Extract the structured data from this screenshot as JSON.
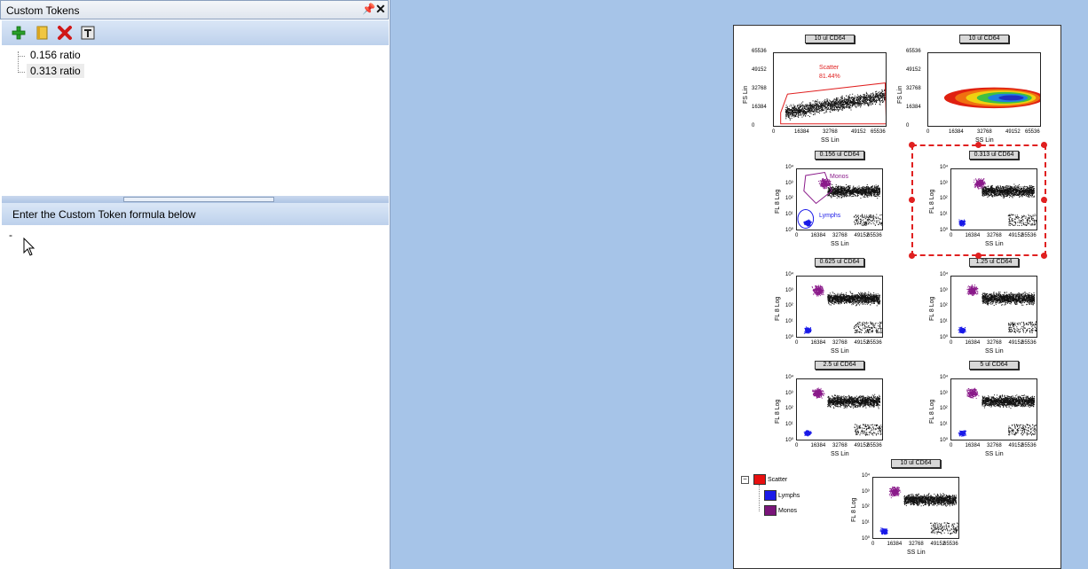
{
  "panel": {
    "title": "Custom Tokens",
    "pin_glyph": "⬇",
    "close_glyph": "✕",
    "toolbar": {
      "add_icon": "add-icon",
      "copy_icon": "copy-icon",
      "delete_icon": "delete-icon",
      "text_icon": "text-icon"
    },
    "tokens": [
      "0.156 ratio",
      "0.313 ratio"
    ],
    "formula_label": "Enter the Custom Token formula below",
    "formula_value": "-"
  },
  "plots": [
    {
      "title": "10  ul CD64",
      "ylabel": "FS Lin",
      "xlabel": "SS Lin",
      "yticks": [
        "65536",
        "49152",
        "32768",
        "16384",
        "0"
      ],
      "xticks": [
        "0",
        "16384",
        "32768",
        "49152",
        "65536"
      ],
      "gate": "Scatter",
      "gate_pct": "81.44%"
    },
    {
      "title": "10  ul CD64",
      "ylabel": "FS Lin",
      "xlabel": "SS Lin",
      "yticks": [
        "65536",
        "49152",
        "32768",
        "16384",
        "0"
      ],
      "xticks": [
        "0",
        "16384",
        "32768",
        "49152",
        "65536"
      ]
    },
    {
      "title": "0.156  ul CD64",
      "ylabel": "FL 8 Log",
      "xlabel": "SS Lin",
      "yticks": [
        "10⁴",
        "10³",
        "10²",
        "10¹",
        "10⁰"
      ],
      "xticks": [
        "0",
        "16384",
        "32768",
        "49152",
        "65536"
      ],
      "gate_monos": "Monos",
      "gate_lymphs": "Lymphs"
    },
    {
      "title": "0.313  ul CD64",
      "ylabel": "FL 8 Log",
      "xlabel": "SS Lin",
      "yticks": [
        "10⁴",
        "10³",
        "10²",
        "10¹",
        "10⁰"
      ],
      "xticks": [
        "0",
        "16384",
        "32768",
        "49152",
        "65536"
      ]
    },
    {
      "title": "0.625  ul CD64",
      "ylabel": "FL 8 Log",
      "xlabel": "SS Lin",
      "yticks": [
        "10⁴",
        "10³",
        "10²",
        "10¹",
        "10⁰"
      ],
      "xticks": [
        "0",
        "16384",
        "32768",
        "49152",
        "65536"
      ]
    },
    {
      "title": "1.25  ul CD64",
      "ylabel": "FL 8 Log",
      "xlabel": "SS Lin",
      "yticks": [
        "10⁴",
        "10³",
        "10²",
        "10¹",
        "10⁰"
      ],
      "xticks": [
        "0",
        "16384",
        "32768",
        "49152",
        "65536"
      ]
    },
    {
      "title": "2.5  ul CD64",
      "ylabel": "FL 8 Log",
      "xlabel": "SS Lin",
      "yticks": [
        "10⁴",
        "10³",
        "10²",
        "10¹",
        "10⁰"
      ],
      "xticks": [
        "0",
        "16384",
        "32768",
        "49152",
        "65536"
      ]
    },
    {
      "title": "5  ul CD64",
      "ylabel": "FL 8 Log",
      "xlabel": "SS Lin",
      "yticks": [
        "10⁴",
        "10³",
        "10²",
        "10¹",
        "10⁰"
      ],
      "xticks": [
        "0",
        "16384",
        "32768",
        "49152",
        "65536"
      ]
    },
    {
      "title": "10  ul CD64",
      "ylabel": "FL 8 Log",
      "xlabel": "SS Lin",
      "yticks": [
        "10⁴",
        "10³",
        "10²",
        "10¹",
        "10⁰"
      ],
      "xticks": [
        "0",
        "16384",
        "32768",
        "49152",
        "65536"
      ]
    }
  ],
  "legend": {
    "collapse_glyph": "−",
    "items": [
      {
        "label": "Scatter",
        "color": "#e81010"
      },
      {
        "label": "Lymphs",
        "color": "#1a1ae8"
      },
      {
        "label": "Monos",
        "color": "#7a147a"
      }
    ]
  },
  "colors": {
    "lymphs": "#1a1ae8",
    "monos": "#8a1a8a",
    "events": "#111111",
    "gate": "#e02020"
  }
}
